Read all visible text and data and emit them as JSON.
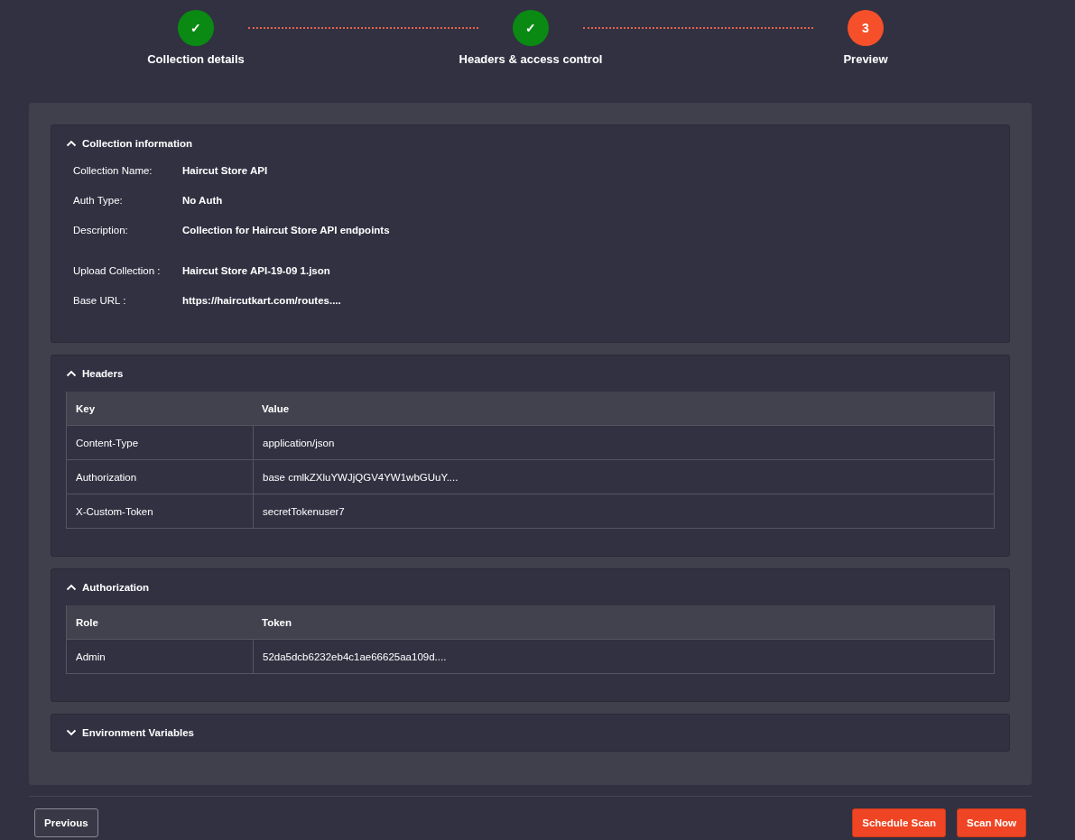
{
  "stepper": {
    "steps": [
      {
        "label": "Collection details",
        "kind": "done",
        "marker": "✓"
      },
      {
        "label": "Headers & access control",
        "kind": "done",
        "marker": "✓"
      },
      {
        "label": "Preview",
        "kind": "current",
        "marker": "3"
      }
    ]
  },
  "sections": [
    {
      "title": "Collection information",
      "expanded": true,
      "kind": "fields",
      "fields": [
        {
          "label": "Collection Name:",
          "value": "Haircut Store API"
        },
        {
          "label": "Auth Type:",
          "value": "No Auth"
        },
        {
          "label": "Description:",
          "value": "Collection for Haircut Store API endpoints"
        },
        {
          "label": "Upload Collection :",
          "value": "Haircut Store API-19-09 1.json"
        },
        {
          "label": "Base URL :",
          "value": "https://haircutkart.com/routes...."
        }
      ]
    },
    {
      "title": "Headers",
      "expanded": true,
      "kind": "table",
      "columns": [
        "Key",
        "Value"
      ],
      "rows": [
        [
          "Content-Type",
          "application/json"
        ],
        [
          "Authorization",
          "base cmlkZXluYWJjQGV4YW1wbGUuY...."
        ],
        [
          "X-Custom-Token",
          "secretTokenuser7"
        ]
      ]
    },
    {
      "title": "Authorization",
      "expanded": true,
      "kind": "table",
      "columns": [
        "Role",
        "Token"
      ],
      "rows": [
        [
          "Admin",
          "52da5dcb6232eb4c1ae66625aa109d...."
        ]
      ]
    },
    {
      "title": "Environment Variables",
      "expanded": false
    }
  ],
  "footer": {
    "previous": "Previous",
    "actions": [
      "Schedule Scan",
      "Scan Now"
    ]
  }
}
